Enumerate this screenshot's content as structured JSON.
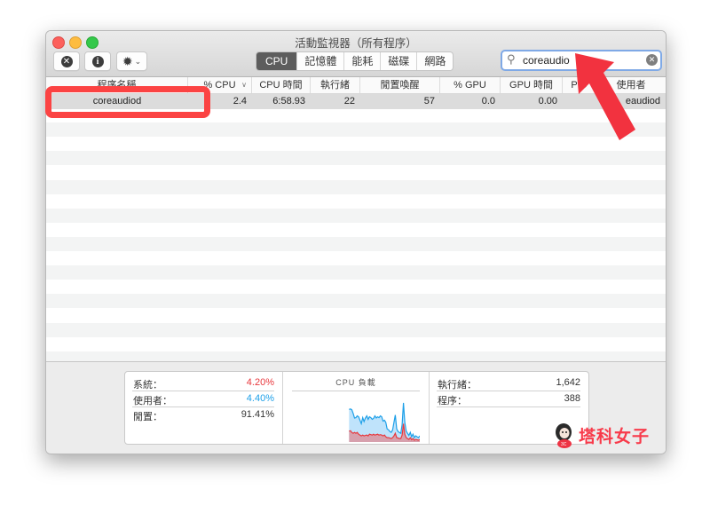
{
  "window": {
    "title": "活動監視器（所有程序）",
    "toolbar": {
      "stop_button": "stop-process",
      "info_button": "inspect-process",
      "gear_button": "actions-menu"
    },
    "tabs": [
      {
        "label": "CPU",
        "active": true
      },
      {
        "label": "記憶體",
        "active": false
      },
      {
        "label": "能耗",
        "active": false
      },
      {
        "label": "磁碟",
        "active": false
      },
      {
        "label": "網路",
        "active": false
      }
    ],
    "search": {
      "value": "coreaudio",
      "icon": "search-icon",
      "clear_icon": "clear-icon"
    }
  },
  "table": {
    "columns": [
      "程序名稱",
      "% CPU",
      "CPU 時間",
      "執行緒",
      "閒置喚醒",
      "% GPU",
      "GPU 時間",
      "PID",
      "使用者"
    ],
    "sort_column": "% CPU",
    "sort_direction": "descending",
    "rows": [
      {
        "name": "coreaudiod",
        "cpu": "2.4",
        "cpu_time": "6:58.93",
        "threads": "22",
        "idle_wakeups": "57",
        "gpu": "0.0",
        "gpu_time": "0.00",
        "pid": "",
        "user": "_coreaudiod"
      }
    ],
    "visible_user_fragment": "eaudiod"
  },
  "summary": {
    "system_label": "系統：",
    "system_value": "4.20%",
    "user_label": "使用者：",
    "user_value": "4.40%",
    "idle_label": "閒置：",
    "idle_value": "91.41%",
    "graph_title": "CPU 負載",
    "threads_label": "執行緒：",
    "threads_value": "1,642",
    "processes_label": "程序：",
    "processes_value": "388",
    "colors": {
      "system": "#e8383d",
      "user": "#1ea0e8"
    }
  },
  "cpu_load_graph": {
    "user": [
      0,
      0,
      0,
      0,
      0,
      0,
      0,
      0,
      0,
      0,
      0,
      0,
      0,
      0,
      0,
      0,
      0,
      0,
      0,
      0,
      0,
      0,
      0,
      0,
      0,
      0,
      0,
      0,
      0,
      0,
      0,
      0,
      0,
      0,
      0,
      0,
      0,
      0,
      0,
      0,
      0,
      0,
      0.75,
      0.76,
      0.74,
      0.66,
      0.55,
      0.56,
      0.6,
      0.58,
      0.5,
      0.42,
      0.56,
      0.47,
      0.55,
      0.6,
      0.52,
      0.58,
      0.56,
      0.52,
      0.54,
      0.6,
      0.55,
      0.58,
      0.56,
      0.6,
      0.58,
      0.48,
      0.5,
      0.45,
      0.3,
      0.28,
      0.24,
      0.22,
      0.28,
      0.45,
      0.62,
      0.3,
      0.24,
      0.22,
      0.2,
      0.4,
      0.9,
      0.45,
      0.25,
      0.2,
      0.15,
      0.22,
      0.12,
      0.18,
      0.1,
      0.14,
      0.12,
      0.1,
      0.14
    ],
    "system": [
      0,
      0,
      0,
      0,
      0,
      0,
      0,
      0,
      0,
      0,
      0,
      0,
      0,
      0,
      0,
      0,
      0,
      0,
      0,
      0,
      0,
      0,
      0,
      0,
      0,
      0,
      0,
      0,
      0,
      0,
      0,
      0,
      0,
      0,
      0,
      0,
      0,
      0,
      0,
      0,
      0,
      0,
      0.25,
      0.26,
      0.22,
      0.2,
      0.22,
      0.2,
      0.22,
      0.18,
      0.16,
      0.14,
      0.16,
      0.14,
      0.15,
      0.16,
      0.14,
      0.18,
      0.17,
      0.16,
      0.18,
      0.16,
      0.17,
      0.18,
      0.16,
      0.17,
      0.16,
      0.14,
      0.16,
      0.12,
      0.1,
      0.1,
      0.09,
      0.08,
      0.1,
      0.14,
      0.2,
      0.1,
      0.09,
      0.08,
      0.08,
      0.16,
      0.42,
      0.18,
      0.1,
      0.08,
      0.06,
      0.1,
      0.05,
      0.08,
      0.04,
      0.06,
      0.05,
      0.04,
      0.06
    ]
  },
  "annotations": {
    "highlight_target": "coreaudiod",
    "arrow_target": "search-field",
    "watermark": "塔科女子"
  }
}
